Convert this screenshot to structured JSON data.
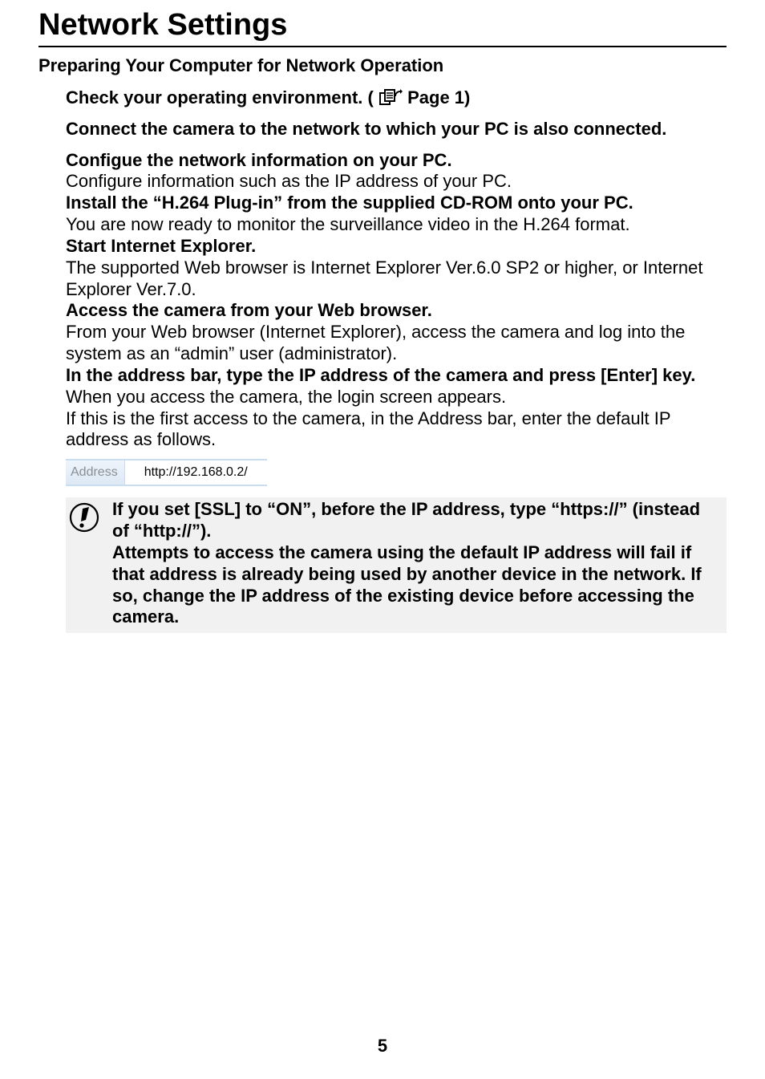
{
  "title": "Network Settings",
  "section_heading": "Preparing Your Computer for Network Operation",
  "step1": {
    "prefix": "Check your operating environment. (",
    "page_ref": "Page 1)"
  },
  "step2": "Connect the camera to the network to which your PC is also connected.",
  "step3": {
    "head": "Configue the network information on your PC.",
    "body": "Configure information such as the IP address of your PC."
  },
  "step4": {
    "head": "Install the “H.264 Plug-in” from the supplied CD-ROM onto your PC.",
    "body": "You are now ready to monitor the surveillance video in the H.264 format."
  },
  "step5": {
    "head": "Start Internet Explorer.",
    "body": "The supported Web browser is Internet Explorer Ver.6.0 SP2 or higher, or Internet Explorer Ver.7.0."
  },
  "step6": {
    "head": "Access the camera from your Web browser.",
    "body": "From your Web browser (Internet Explorer), access the camera and log into the system as an “admin” user (administrator)."
  },
  "step7": {
    "head": "In the address bar, type the IP address of the camera and press [Enter] key.",
    "body1": "When you access the camera, the login screen appears.",
    "body2": "If this is the first access to the camera, in the Address bar, enter the default IP address as follows."
  },
  "address_bar": {
    "label": "Address",
    "url": "http://192.168.0.2/"
  },
  "note": {
    "line1": "If you set [SSL] to “ON”, before the IP address, type “https://” (instead of “http://”).",
    "line2": "Attempts to access the camera using the default IP address will fail if that address is already being used by another device in the network. If so, change the IP address of the existing device before accessing the camera."
  },
  "page_number": "5"
}
